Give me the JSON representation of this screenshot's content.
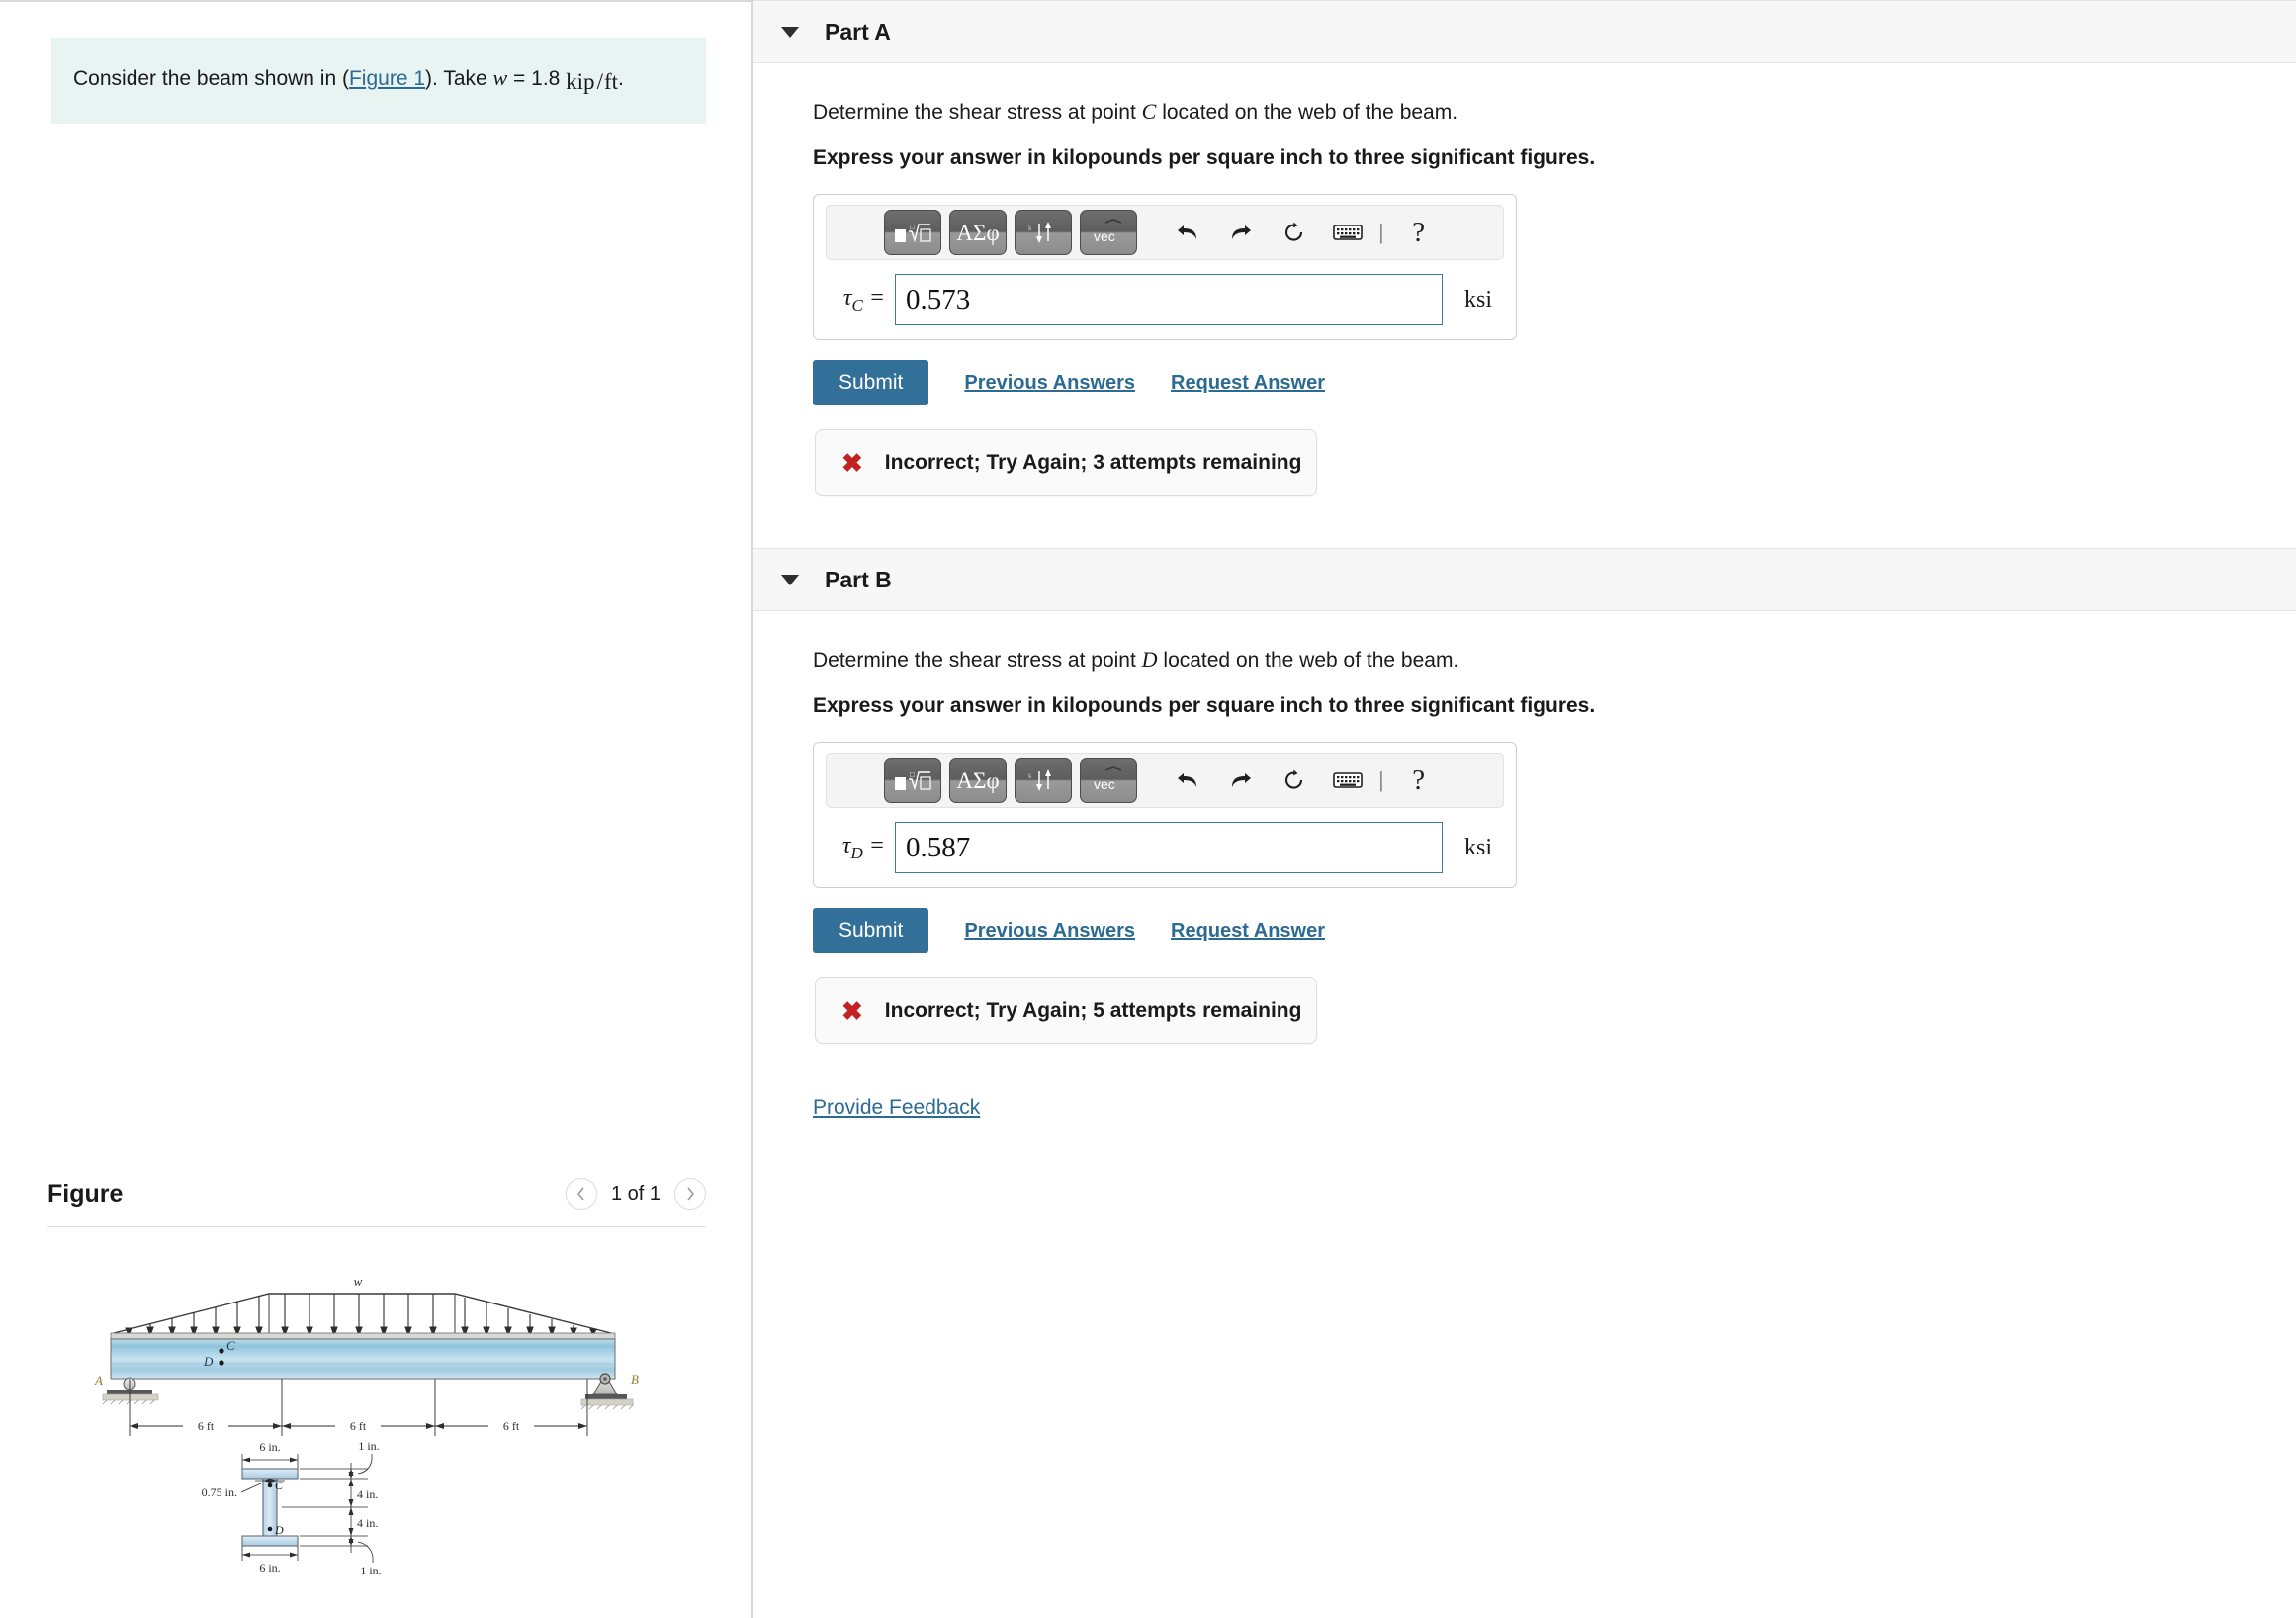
{
  "problem": {
    "text_before_link": "Consider the beam shown in (",
    "figure_link": "Figure 1",
    "text_after_link": "). Take ",
    "variable": "w",
    "equals": " = 1.8 ",
    "unit_numerator": "kip",
    "unit_slash": "/",
    "unit_denominator": "ft",
    "period": "."
  },
  "figure": {
    "title": "Figure",
    "pagination": "1 of 1",
    "prev_icon": "chevron-left-icon",
    "next_icon": "chevron-right-icon",
    "diagram": {
      "load_label": "w",
      "support_a_label": "A",
      "support_b_label": "B",
      "point_c_label": "C",
      "point_d_label": "D",
      "span_labels": [
        "6 ft",
        "6 ft",
        "6 ft"
      ],
      "cross_section": {
        "top_flange_width": "6 in.",
        "bottom_flange_width": "6 in.",
        "web_thickness": "0.75 in.",
        "top_flange_thickness": "1 in.",
        "bottom_flange_thickness": "1 in.",
        "upper_web_height": "4 in.",
        "lower_web_height": "4 in.",
        "point_c_label": "C",
        "point_d_label": "D"
      }
    }
  },
  "toolbar": {
    "buttons": [
      {
        "name": "math-template-button",
        "glyph": "template"
      },
      {
        "name": "greek-symbols-button",
        "glyph": "ΑΣφ"
      },
      {
        "name": "sub-superscript-button",
        "glyph": "updown"
      },
      {
        "name": "vector-button",
        "glyph": "vec"
      }
    ],
    "icons": [
      {
        "name": "undo-icon",
        "label": "undo"
      },
      {
        "name": "redo-icon",
        "label": "redo"
      },
      {
        "name": "reset-icon",
        "label": "reset"
      },
      {
        "name": "keyboard-icon",
        "label": "keyboard"
      },
      {
        "name": "help-icon",
        "label": "?"
      }
    ]
  },
  "parts": [
    {
      "id": "part-a",
      "title": "Part A",
      "question": "Determine the shear stress at point C located on the web of the beam.",
      "question_pre": "Determine the shear stress at point ",
      "question_var": "C",
      "question_post": " located on the web of the beam.",
      "instruction": "Express your answer in kilopounds per square inch to three significant figures.",
      "variable_base": "τ",
      "variable_sub": "C",
      "variable_equals": "=",
      "answer_value": "0.573",
      "placeholder": "",
      "unit": "ksi",
      "submit_label": "Submit",
      "previous_answers_label": "Previous Answers",
      "request_answer_label": "Request Answer",
      "feedback_icon": "x-mark-icon",
      "feedback_text": "Incorrect; Try Again; 3 attempts remaining"
    },
    {
      "id": "part-b",
      "title": "Part B",
      "question": "Determine the shear stress at point D located on the web of the beam.",
      "question_pre": "Determine the shear stress at point ",
      "question_var": "D",
      "question_post": " located on the web of the beam.",
      "instruction": "Express your answer in kilopounds per square inch to three significant figures.",
      "variable_base": "τ",
      "variable_sub": "D",
      "variable_equals": "=",
      "answer_value": "0.587",
      "placeholder": "",
      "unit": "ksi",
      "submit_label": "Submit",
      "previous_answers_label": "Previous Answers",
      "request_answer_label": "Request Answer",
      "feedback_icon": "x-mark-icon",
      "feedback_text": "Incorrect; Try Again; 5 attempts remaining"
    }
  ],
  "footer": {
    "provide_feedback_label": "Provide Feedback"
  },
  "colors": {
    "submit_button": "#337099",
    "link": "#2b6a93",
    "problem_background": "#e8f4f2",
    "part_header_background": "#f7f7f7",
    "error_mark": "#c32222",
    "input_border": "#3d7a9c"
  }
}
